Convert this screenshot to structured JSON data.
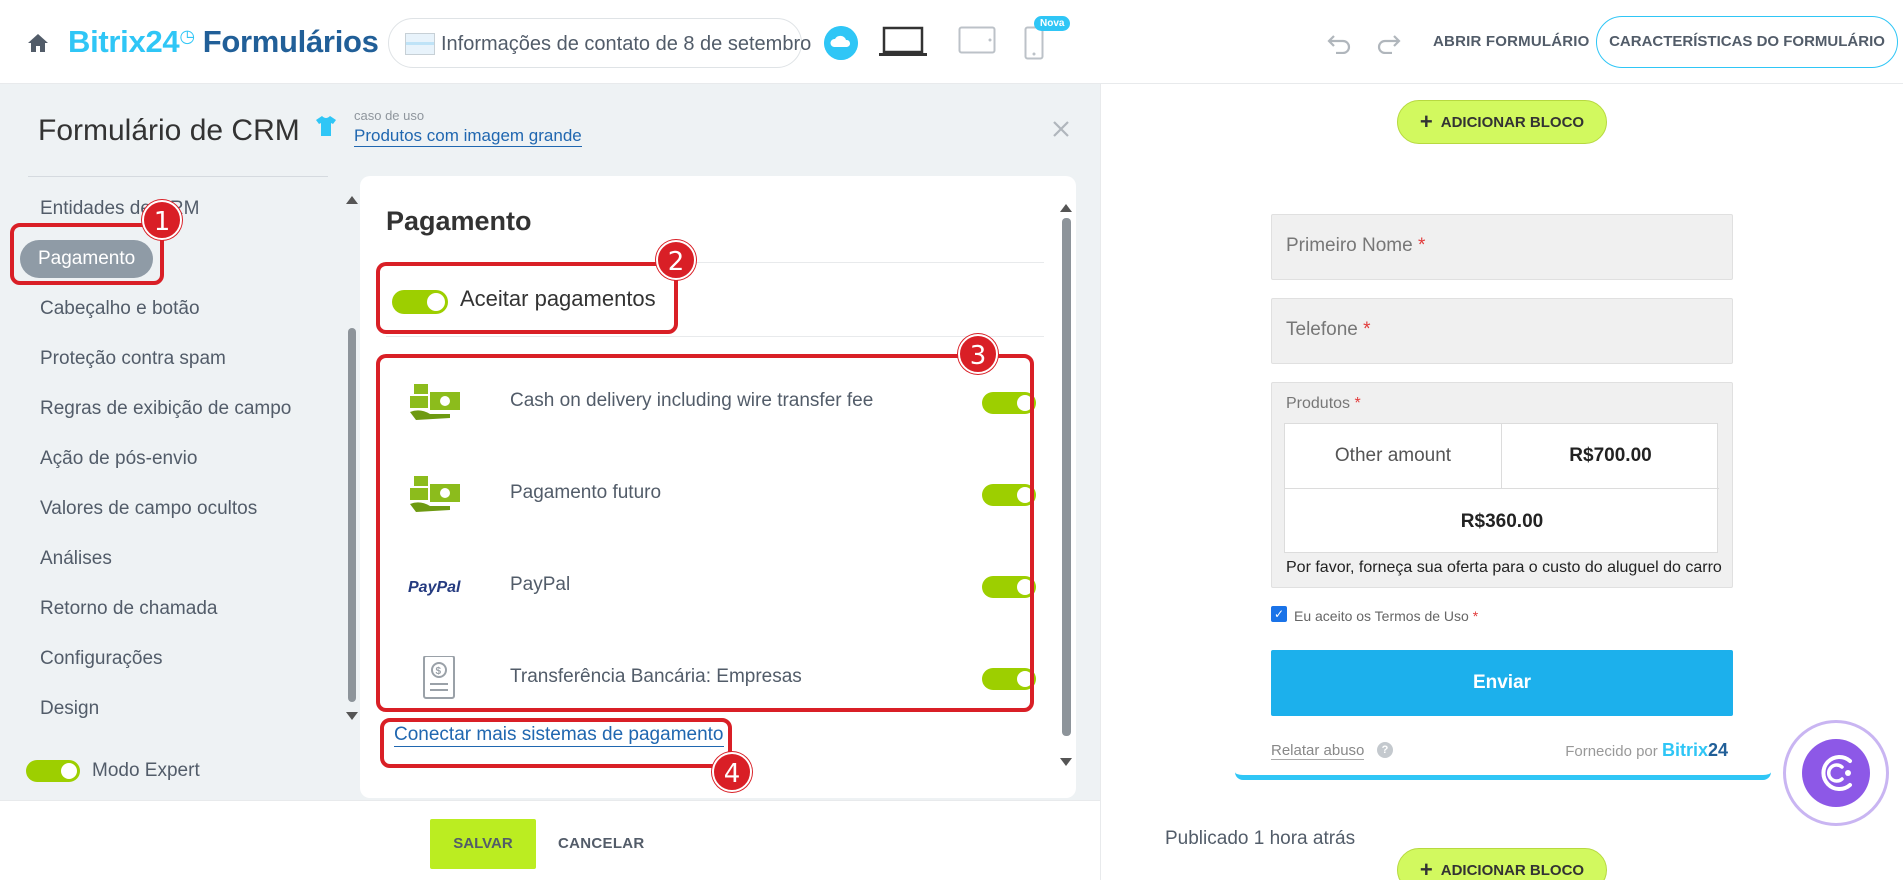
{
  "header": {
    "logo_brand": "Bitrix24",
    "logo_product": "Formulários",
    "form_title": "Informações de contato de 8 de setembro",
    "new_badge": "Nova",
    "open_form": "ABRIR FORMULÁRIO",
    "form_properties": "CARACTERÍSTICAS DO FORMULÁRIO"
  },
  "panel": {
    "title": "Formulário de CRM",
    "usecase_label": "caso de uso",
    "usecase_value": "Produtos com imagem grande"
  },
  "sidebar": {
    "items": [
      {
        "label": "Entidades de CRM"
      },
      {
        "label": "Pagamento",
        "active": true
      },
      {
        "label": "Cabeçalho e botão"
      },
      {
        "label": "Proteção contra spam"
      },
      {
        "label": "Regras de exibição de campo"
      },
      {
        "label": "Ação de pós-envio"
      },
      {
        "label": "Valores de campo ocultos"
      },
      {
        "label": "Análises"
      },
      {
        "label": "Retorno de chamada"
      },
      {
        "label": "Configurações"
      },
      {
        "label": "Design"
      }
    ],
    "expert_mode": "Modo Expert"
  },
  "payment": {
    "title": "Pagamento",
    "accept_label": "Aceitar pagamentos",
    "systems": [
      {
        "name": "Cash on delivery including wire transfer fee",
        "icon": "cash-delivery-icon"
      },
      {
        "name": "Pagamento futuro",
        "icon": "cash-delivery-icon"
      },
      {
        "name": "PayPal",
        "icon": "paypal-logo"
      },
      {
        "name": "Transferência Bancária: Empresas",
        "icon": "bank-document-icon"
      }
    ],
    "paypal_logo_text": "PayPal",
    "connect_more": "Conectar mais sistemas de pagamento"
  },
  "annotations": [
    "1",
    "2",
    "3",
    "4"
  ],
  "footer": {
    "save": "SALVAR",
    "cancel": "CANCELAR"
  },
  "preview": {
    "add_block": "ADICIONAR BLOCO",
    "first_name": "Primeiro Nome",
    "phone": "Telefone",
    "products_label": "Produtos",
    "product_other": "Other amount",
    "product_price_1": "R$700.00",
    "product_price_2": "R$360.00",
    "products_hint": "Por favor, forneça sua oferta para o custo do aluguel do carro",
    "terms": "Eu aceito os Termos de Uso",
    "required_mark": "*",
    "send": "Enviar",
    "report_abuse": "Relatar abuso",
    "powered_by": "Fornecido por",
    "powered_brand": "Bitrix",
    "powered_brand_num": "24",
    "published": "Publicado 1 hora atrás"
  },
  "colors": {
    "accent_blue": "#2fc6f6",
    "toggle_green": "#9dcf00",
    "annotation_red": "#d91f26",
    "submit_blue": "#1cb0ec"
  }
}
